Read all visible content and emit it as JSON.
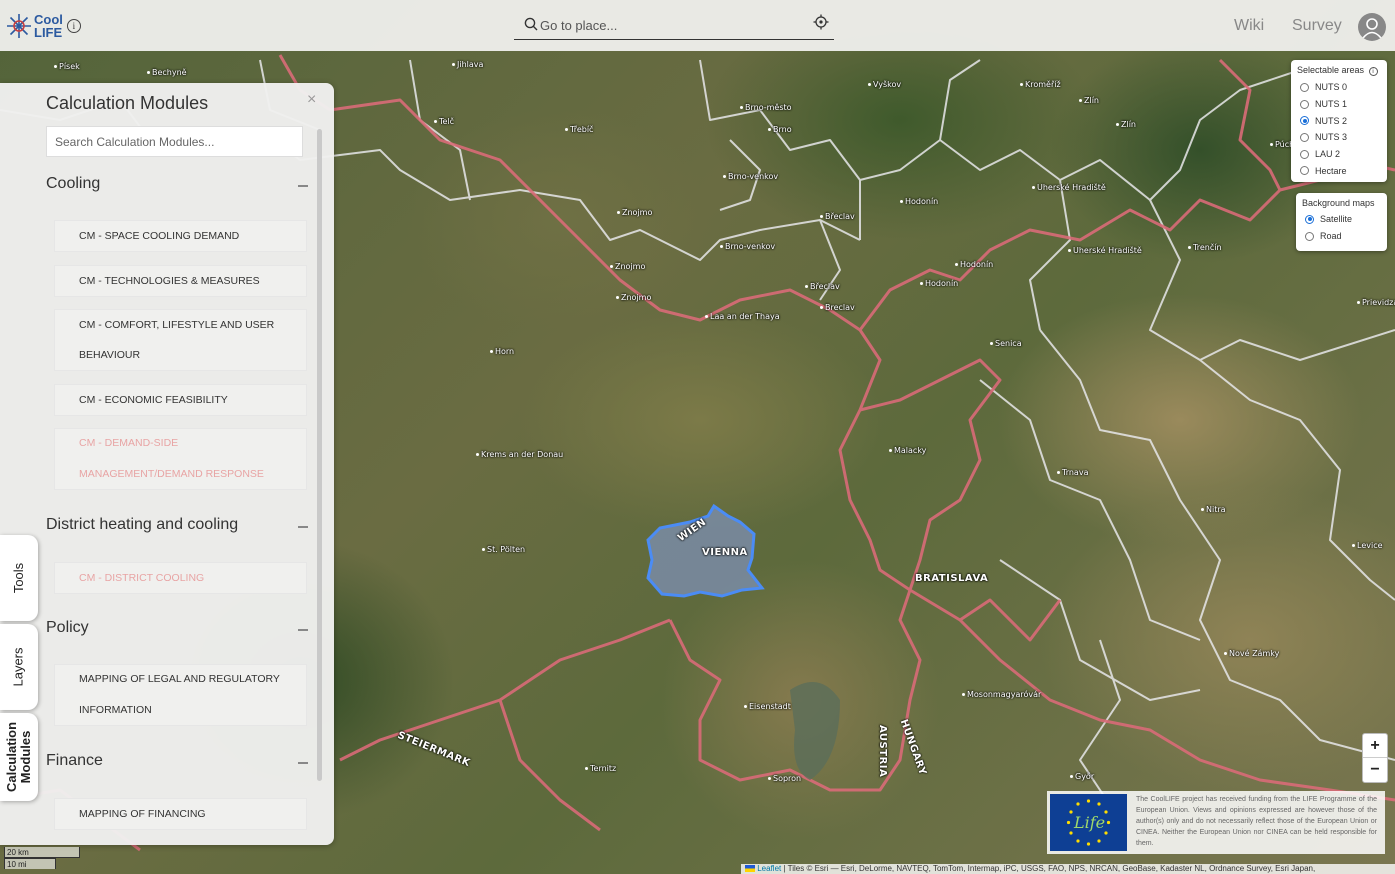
{
  "header": {
    "logo_line1": "Cool",
    "logo_line2": "LIFE",
    "logo_info": "i",
    "search_placeholder": "Go to place...",
    "nav": [
      {
        "label": "Wiki"
      },
      {
        "label": "Survey"
      }
    ]
  },
  "panel": {
    "title": "Calculation Modules",
    "close": "×",
    "search_placeholder": "Search Calculation Modules...",
    "categories": [
      {
        "title": "Cooling",
        "items": [
          {
            "label": "CM - SPACE COOLING DEMAND",
            "enabled": true
          },
          {
            "label": "CM - TECHNOLOGIES & MEASURES",
            "enabled": true
          },
          {
            "label": "CM - COMFORT, LIFESTYLE AND USER BEHAVIOUR",
            "enabled": true
          },
          {
            "label": "CM - ECONOMIC FEASIBILITY",
            "enabled": true
          },
          {
            "label": "CM - DEMAND-SIDE MANAGEMENT/DEMAND RESPONSE",
            "enabled": false
          }
        ]
      },
      {
        "title": "District heating and cooling",
        "items": [
          {
            "label": "CM - DISTRICT COOLING",
            "enabled": false
          }
        ]
      },
      {
        "title": "Policy",
        "items": [
          {
            "label": "MAPPING OF LEGAL AND REGULATORY INFORMATION",
            "enabled": true
          }
        ]
      },
      {
        "title": "Finance",
        "items": [
          {
            "label": "MAPPING OF FINANCING",
            "enabled": true
          }
        ]
      }
    ]
  },
  "side_tabs": [
    {
      "label": "Tools",
      "active": false
    },
    {
      "label": "Layers",
      "active": false
    },
    {
      "label": "Calculation Modules",
      "active": true
    }
  ],
  "selectable_areas": {
    "title": "Selectable areas",
    "info": "i",
    "options": [
      {
        "label": "NUTS 0",
        "selected": false
      },
      {
        "label": "NUTS 1",
        "selected": false
      },
      {
        "label": "NUTS 2",
        "selected": true
      },
      {
        "label": "NUTS 3",
        "selected": false
      },
      {
        "label": "LAU 2",
        "selected": false
      },
      {
        "label": "Hectare",
        "selected": false
      }
    ]
  },
  "background_maps": {
    "title": "Background maps",
    "options": [
      {
        "label": "Satellite",
        "selected": true
      },
      {
        "label": "Road",
        "selected": false
      }
    ]
  },
  "zoom": {
    "in": "+",
    "out": "−"
  },
  "scale": {
    "km": "20 km",
    "mi": "10 mi"
  },
  "eu_notice": {
    "logo_text": "Life",
    "text": "The CoolLIFE project has received funding from the LIFE Programme of the European Union. Views and opinions expressed are however those of the author(s) only and do not necessarily reflect those of the European Union or CINEA. Neither the European Union nor CINEA can be held responsible for them."
  },
  "attribution": {
    "leaflet": "Leaflet",
    "text": " | Tiles © Esri — Esri, DeLorme, NAVTEQ, TomTom, Intermap, iPC, USGS, FAO, NPS, NRCAN, GeoBase, Kadaster NL, Ordnance Survey, Esri Japan,"
  },
  "map_labels": [
    "Písek",
    "Bechyně",
    "Jihlava",
    "Třebíč",
    "Telč",
    "Brno-město",
    "Brno",
    "Brno-venkov",
    "Vyškov",
    "Kroměříž",
    "Zlín",
    "Zlín",
    "Znojmo",
    "Znojmo",
    "Znojmo",
    "Brno-venkov",
    "Břeclav",
    "Hodonín",
    "Hodonín",
    "Uherské Hradiště",
    "Uherské Hradiště",
    "Trenčín",
    "Púchov",
    "Prievidza",
    "Laa an der Thaya",
    "Břeclav",
    "Breclav",
    "Hodonín",
    "Senica",
    "Horn",
    "Malacky",
    "Trnava",
    "Nitra",
    "Krems an der Donau",
    "St. Pölten",
    "WIEN",
    "VIENNA",
    "BRATISLAVA",
    "Levice",
    "Nové Zámky",
    "Mosonmagyaróvár",
    "Eisenstadt",
    "AUSTRIA",
    "HUNGARY",
    "STEIERMARK",
    "Ternitz",
    "Sopron",
    "Győr"
  ],
  "colors": {
    "accent": "#1a6fd8",
    "border_pink": "#d96b78",
    "vienna_fill": "#7d90b4",
    "logo_blue": "#2c5aa0"
  }
}
